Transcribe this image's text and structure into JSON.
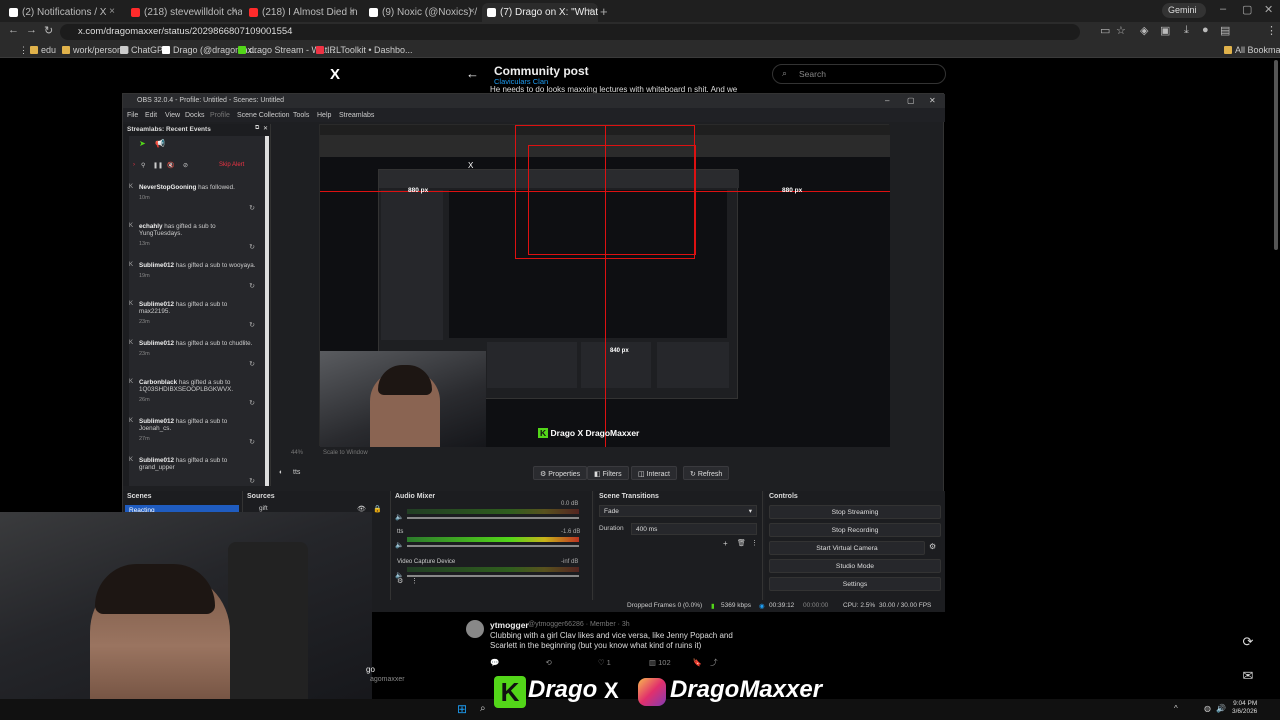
{
  "browser": {
    "tabs": [
      {
        "title": "(2) Notifications / X",
        "color": "#ffffff"
      },
      {
        "title": "(218) stevewilldoit channel - Yo",
        "color": "#ff2b2b"
      },
      {
        "title": "(218) I Almost Died in Chicago",
        "color": "#ff2b2b"
      },
      {
        "title": "(9) Noxic (@Noxics) / X",
        "color": "#ffffff"
      },
      {
        "title": "(7) Drago on X: \"What aspects",
        "color": "#ffffff"
      }
    ],
    "gemini": "Gemini",
    "url": "x.com/dragomaxxer/status/2029866807109001554",
    "bookmarks": [
      {
        "label": "edu",
        "color": "#e0b24b"
      },
      {
        "label": "work/personal",
        "color": "#e0b24b"
      },
      {
        "label": "ChatGPT",
        "color": "#cccccc"
      },
      {
        "label": "Drago (@dragomax...",
        "color": "#ffffff"
      },
      {
        "label": "drago Stream - Wat...",
        "color": "#53d619"
      },
      {
        "label": "IRLToolkit • Dashbo...",
        "color": "#e34"
      }
    ],
    "all_bookmarks": "All Bookmarks"
  },
  "x_page": {
    "logo": "X",
    "post_title": "Community post",
    "post_sub": "Claviculars Clan",
    "post_text": "He needs to do looks maxxing lectures with whiteboard n shit. And we",
    "search_placeholder": "Search"
  },
  "obs": {
    "title": "OBS 32.0.4 - Profile: Untitled - Scenes: Untitled",
    "menu": [
      "File",
      "Edit",
      "View",
      "Docks",
      "Profile",
      "Scene Collection",
      "Tools",
      "Help",
      "Streamlabs"
    ],
    "recent_events_title": "Streamlabs: Recent Events",
    "skip_alert": "Skip Alert",
    "events": [
      {
        "name": "NeverStopGooning",
        "text": "has followed.",
        "time": "10m"
      },
      {
        "name": "echahly",
        "text": "has gifted a sub to YungTuesdays.",
        "time": "13m"
      },
      {
        "name": "Sublime012",
        "text": "has gifted a sub to wooyaya.",
        "time": "19m"
      },
      {
        "name": "Sublime012",
        "text": "has gifted a sub to max22195.",
        "time": "23m"
      },
      {
        "name": "Sublime012",
        "text": "has gifted a sub to chudlite.",
        "time": "23m"
      },
      {
        "name": "Carbonblack",
        "text": "has gifted a sub to 1Q03SHDIBXSEOOPLBGKWVX.",
        "time": "26m"
      },
      {
        "name": "Sublime012",
        "text": "has gifted a sub to Joenah_cs.",
        "time": "27m"
      },
      {
        "name": "Sublime012",
        "text": "has gifted a sub to grand_upper",
        "time": ""
      }
    ],
    "preview_px_label": "880 px",
    "preview_px_label2": "840 px",
    "preview_zoom": "44%",
    "preview_scale": "Scale to Window",
    "source_label": "tts",
    "prop_buttons": [
      "Properties",
      "Filters",
      "Interact",
      "Refresh"
    ],
    "scenes_title": "Scenes",
    "scene_selected": "Reacting",
    "sources_title": "Sources",
    "source_item": "gift",
    "mixer_title": "Audio Mixer",
    "mixer_tracks": [
      {
        "name": "",
        "db": "0.0 dB"
      },
      {
        "name": "tts",
        "db": "-1.6 dB"
      },
      {
        "name": "Video Capture Device",
        "db": "-inf dB"
      }
    ],
    "mixer_scale": [
      "-60",
      "-55",
      "-50",
      "-45",
      "-40",
      "-35",
      "-30",
      "-25",
      "-20",
      "-15",
      "-10",
      "-5",
      "0"
    ],
    "transitions_title": "Scene Transitions",
    "transition": "Fade",
    "duration_label": "Duration",
    "duration_value": "400 ms",
    "controls_title": "Controls",
    "controls": [
      "Stop Streaming",
      "Stop Recording",
      "Start Virtual Camera",
      "Studio Mode",
      "Settings"
    ],
    "status": {
      "dropped": "Dropped Frames 0 (0.0%)",
      "bitrate": "5369 kbps",
      "stream_time": "00:39:12",
      "rec_time": "00:00:00",
      "cpu": "CPU: 2.5%",
      "fps": "30.00 / 30.00 FPS"
    }
  },
  "tweet": {
    "name": "ytmogger",
    "handle": "@ytmogger66286 · Member · 3h",
    "text": "Clubbing with a girl Clav likes and vice versa, like Jenny Popach and Scarlett in the beginning (but you know what kind of ruins it)",
    "likes": "1",
    "views": "102"
  },
  "overlay": {
    "k": "K",
    "name": "Drago",
    "x": "X",
    "handle": "DragoMaxxer"
  },
  "handle_frag": "go",
  "handle_frag2": "agomaxxer",
  "clock": {
    "time": "9:04 PM",
    "date": "3/6/2026"
  },
  "colors": {
    "accent": "#1d9bf0",
    "red_guides": "#dd1111",
    "brand_green": "#53d619"
  }
}
